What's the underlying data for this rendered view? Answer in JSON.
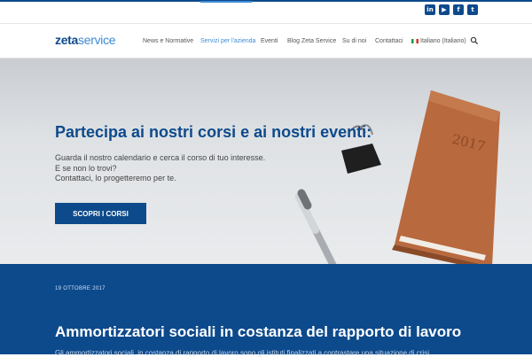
{
  "social": [
    {
      "name": "linkedin-icon",
      "glyph": "in"
    },
    {
      "name": "youtube-icon",
      "glyph": "▶"
    },
    {
      "name": "facebook-icon",
      "glyph": "f"
    },
    {
      "name": "twitter-icon",
      "glyph": "t"
    }
  ],
  "logo": {
    "part1": "zeta",
    "part2": "service"
  },
  "nav": {
    "items": [
      {
        "label": "News e Normative"
      },
      {
        "label": "Servizi per l'azienda",
        "active": true
      },
      {
        "label": "Eventi"
      },
      {
        "label": "Blog Zeta Service"
      },
      {
        "label": "Su di noi"
      },
      {
        "label": "Contattaci"
      },
      {
        "label": "Italiano (Italiano)"
      }
    ]
  },
  "hero": {
    "title": "Partecipa ai nostri corsi e ai nostri eventi:",
    "line1": "Guarda il nostro calendario e cerca il corso di tuo interesse.",
    "line2": "E se non lo trovi?",
    "line3": "Contattaci, lo progetteremo per te.",
    "cta": "SCOPRI I CORSI",
    "notebook_year": "2017"
  },
  "article": {
    "date": "19 OTTOBRE 2017",
    "title": "Ammortizzatori sociali in costanza del rapporto di lavoro",
    "excerpt": "Gli ammortizzatori sociali, in costanza di rapporto di lavoro sono gli istituti finalizzati a contrastare una situazione di crisi"
  },
  "colors": {
    "brand": "#0d4a8c",
    "accent": "#3d8bd4"
  }
}
